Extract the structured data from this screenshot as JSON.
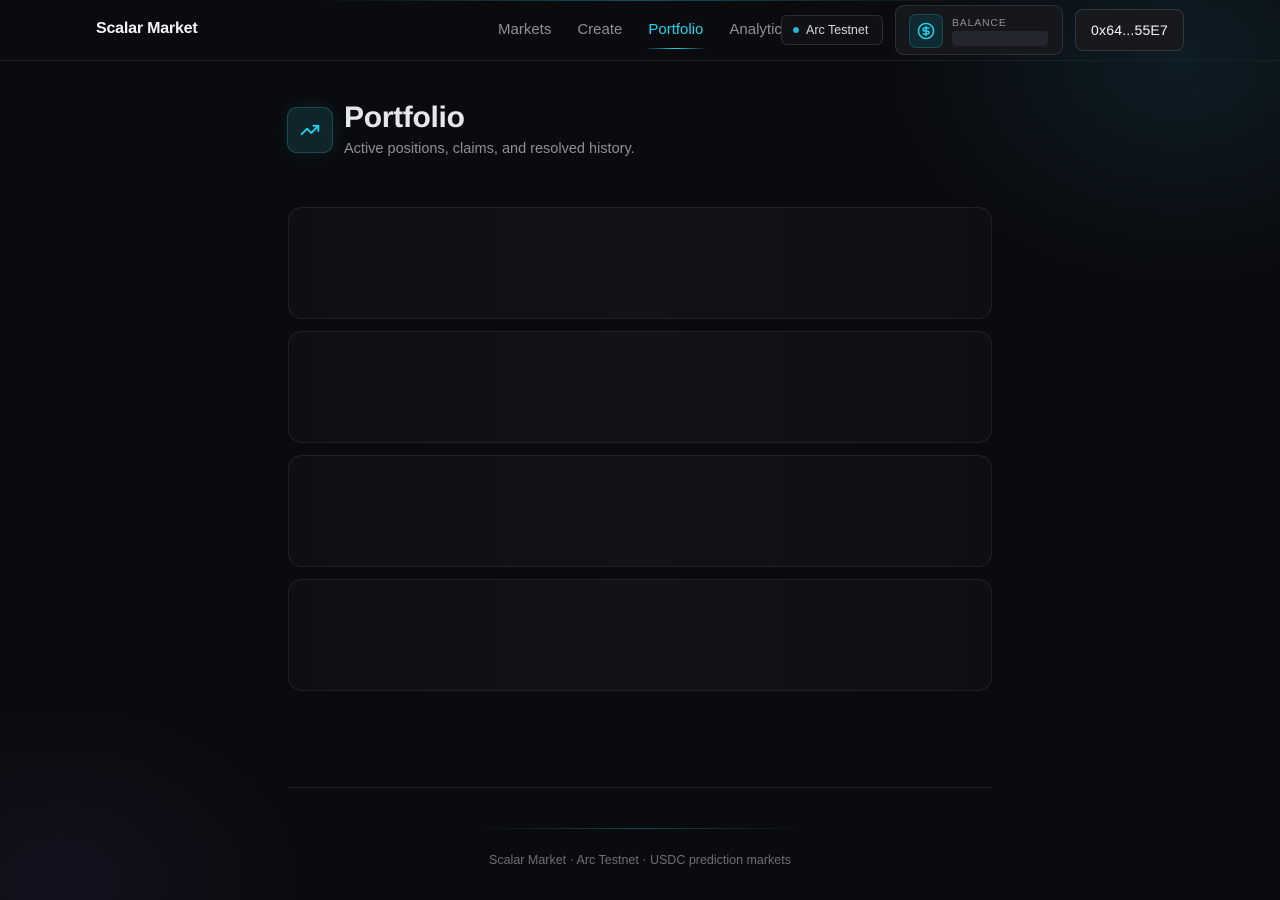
{
  "header": {
    "brand": "Scalar Market",
    "nav": [
      {
        "label": "Markets",
        "active": false
      },
      {
        "label": "Create",
        "active": false
      },
      {
        "label": "Portfolio",
        "active": true
      },
      {
        "label": "Analytics",
        "active": false
      }
    ],
    "network": "Arc Testnet",
    "balance_label": "BALANCE",
    "wallet": "0x64...55E7"
  },
  "page": {
    "title": "Portfolio",
    "subtitle": "Active positions, claims, and resolved history."
  },
  "cards_loading": 4,
  "footer": {
    "text": "Scalar Market · Arc Testnet · USDC prediction markets"
  },
  "colors": {
    "accent": "#22d3ee",
    "background": "#0a0b0e",
    "muted_text": "#8b8f98"
  },
  "icons": {
    "page_icon": "trending-up-icon",
    "balance_icon": "dollar-coin-icon"
  }
}
